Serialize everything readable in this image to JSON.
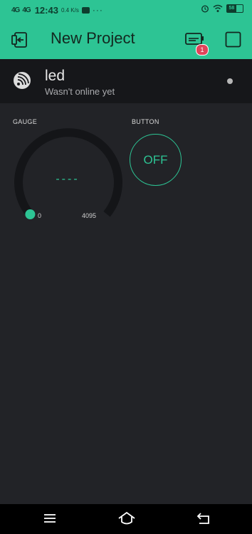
{
  "status_bar": {
    "signal1": "4G",
    "signal2": "4G",
    "time": "12:43",
    "speed": "0.4 K/s",
    "more": "···",
    "battery": "58"
  },
  "header": {
    "title": "New Project",
    "notification_count": "1",
    "icons": [
      "device-select-icon",
      "devices-icon",
      "play-icon"
    ]
  },
  "device": {
    "name": "led",
    "status": "Wasn't online yet",
    "icon": "esp-wifi-icon"
  },
  "widgets": {
    "gauge": {
      "label": "GAUGE",
      "value": "----",
      "min": "0",
      "max": "4095",
      "level_fraction": 0
    },
    "button": {
      "label": "BUTTON",
      "state": "OFF"
    }
  },
  "nav": {
    "icons": [
      "menu-icon",
      "home-icon",
      "back-icon"
    ]
  },
  "colors": {
    "accent": "#2dc494",
    "background": "#222327",
    "device_bar": "#16171a",
    "badge": "#e0435a",
    "gauge_track": "#141518"
  }
}
